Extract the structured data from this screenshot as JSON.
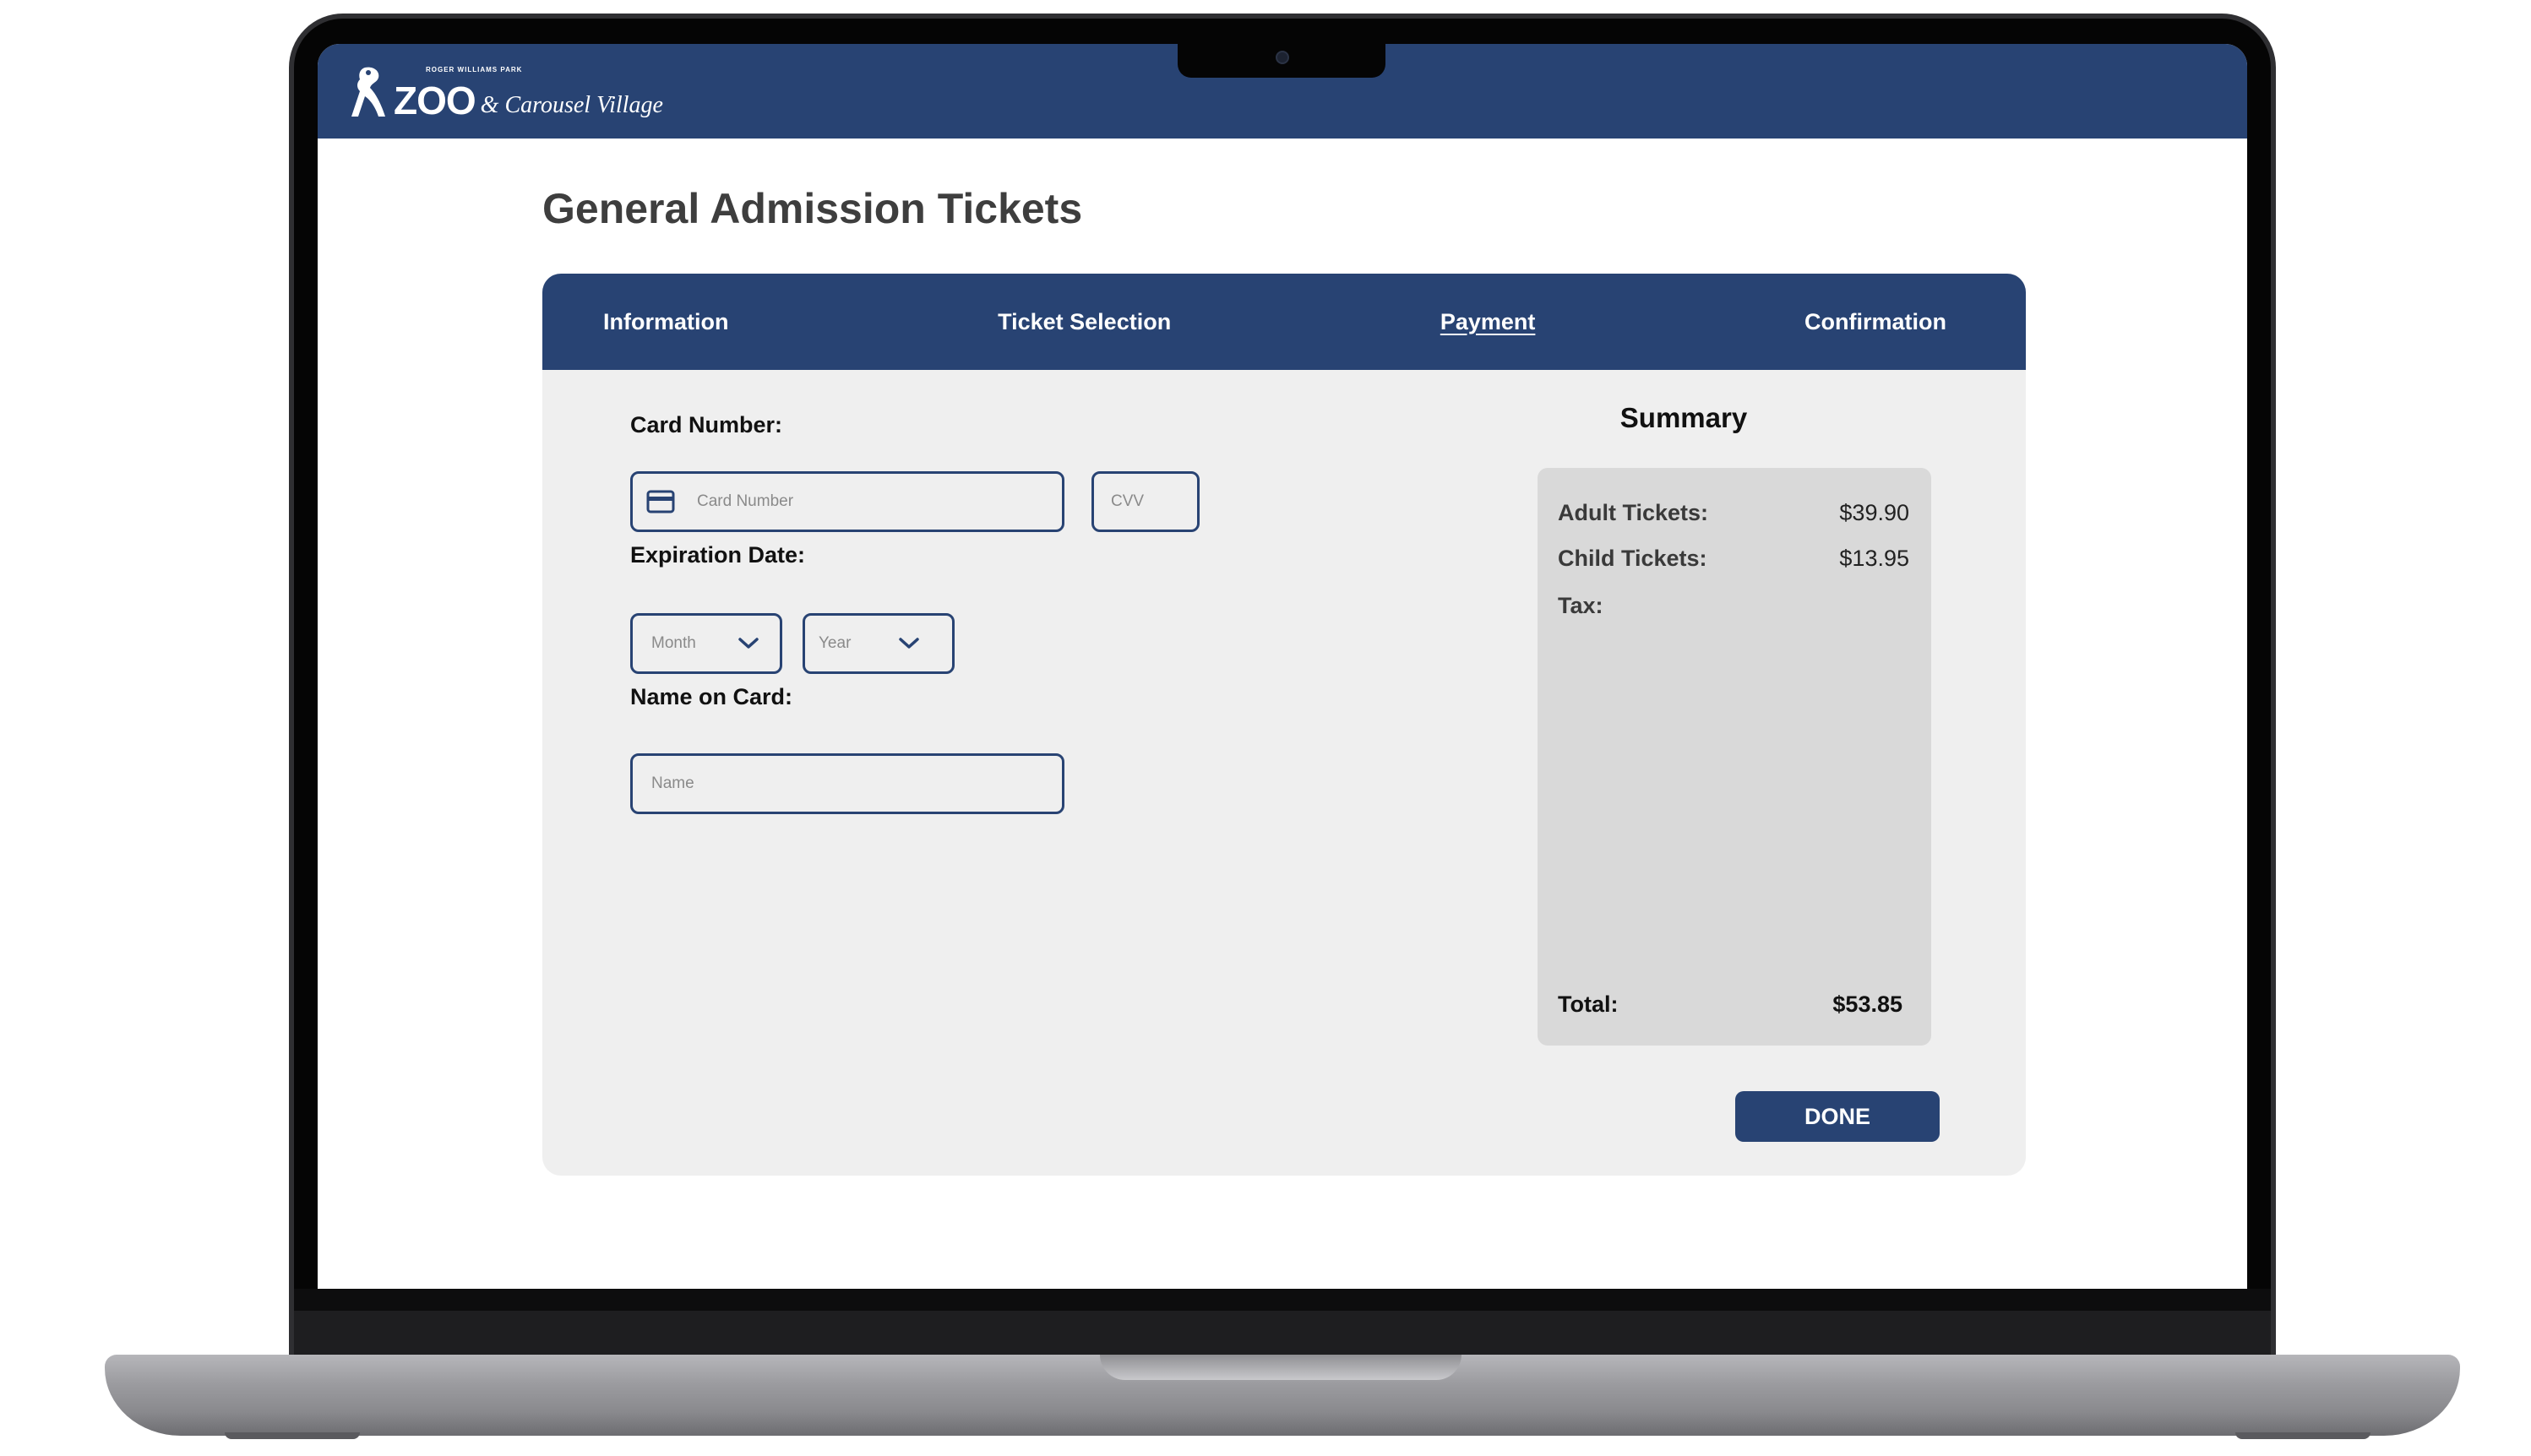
{
  "header": {
    "logo_small": "ROGER WILLIAMS PARK",
    "logo_zoo": "ZOO",
    "logo_rest": "& Carousel Village"
  },
  "page": {
    "title": "General Admission Tickets"
  },
  "steps": [
    {
      "label": "Information",
      "active": false
    },
    {
      "label": "Ticket Selection",
      "active": false
    },
    {
      "label": "Payment",
      "active": true
    },
    {
      "label": "Confirmation",
      "active": false
    }
  ],
  "form": {
    "card_number_label": "Card Number:",
    "card_number_placeholder": "Card Number",
    "cvv_placeholder": "CVV",
    "expiration_label": "Expiration Date:",
    "month_placeholder": "Month",
    "year_placeholder": "Year",
    "name_label": "Name on Card:",
    "name_placeholder": "Name"
  },
  "summary": {
    "title": "Summary",
    "rows": [
      {
        "label": "Adult Tickets:",
        "value": "$39.90"
      },
      {
        "label": "Child Tickets:",
        "value": "$13.95"
      },
      {
        "label": "Tax:",
        "value": ""
      }
    ],
    "total_label": "Total:",
    "total_value": "$53.85"
  },
  "actions": {
    "done_label": "DONE"
  },
  "colors": {
    "brand_navy": "#284373",
    "panel_bg": "#efefef",
    "summary_bg": "#d9d9d9"
  }
}
